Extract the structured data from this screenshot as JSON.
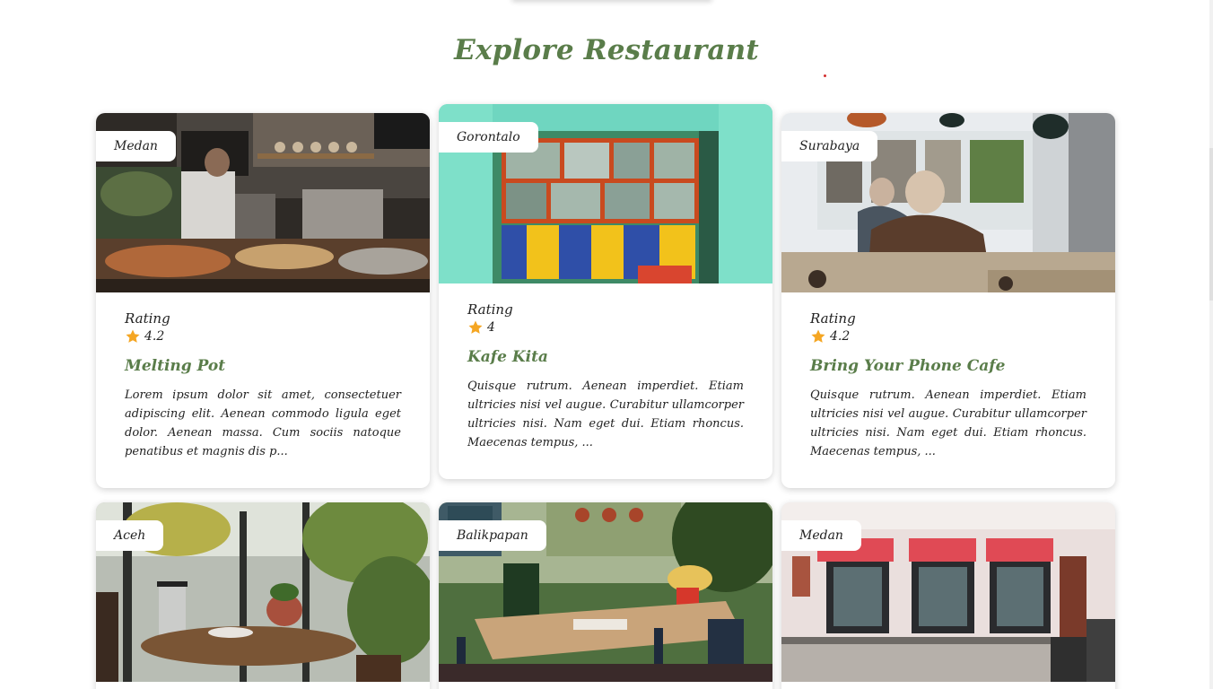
{
  "section": {
    "title": "Explore Restaurant"
  },
  "restaurants": [
    {
      "city": "Medan",
      "rating_label": "Rating",
      "rating": "4.2",
      "name": "Melting Pot",
      "description": "Lorem ipsum dolor sit amet, consectetuer adipiscing elit. Aenean commodo ligula eget dolor. Aenean massa. Cum sociis natoque penatibus et magnis dis p..."
    },
    {
      "city": "Gorontalo",
      "rating_label": "Rating",
      "rating": "4",
      "name": "Kafe Kita",
      "description": "Quisque rutrum. Aenean imperdiet. Etiam ultricies nisi vel augue. Curabitur ullamcorper ultricies nisi. Nam eget dui. Etiam rhoncus. Maecenas tempus, ..."
    },
    {
      "city": "Surabaya",
      "rating_label": "Rating",
      "rating": "4.2",
      "name": "Bring Your Phone Cafe",
      "description": "Quisque rutrum. Aenean imperdiet. Etiam ultricies nisi vel augue. Curabitur ullamcorper ultricies nisi. Nam eget dui. Etiam rhoncus. Maecenas tempus, ..."
    },
    {
      "city": "Aceh"
    },
    {
      "city": "Balikpapan"
    },
    {
      "city": "Medan"
    }
  ],
  "icons": {
    "rating": "star-icon"
  },
  "colors": {
    "accent": "#5a7d4a",
    "star": "#f5a623"
  }
}
